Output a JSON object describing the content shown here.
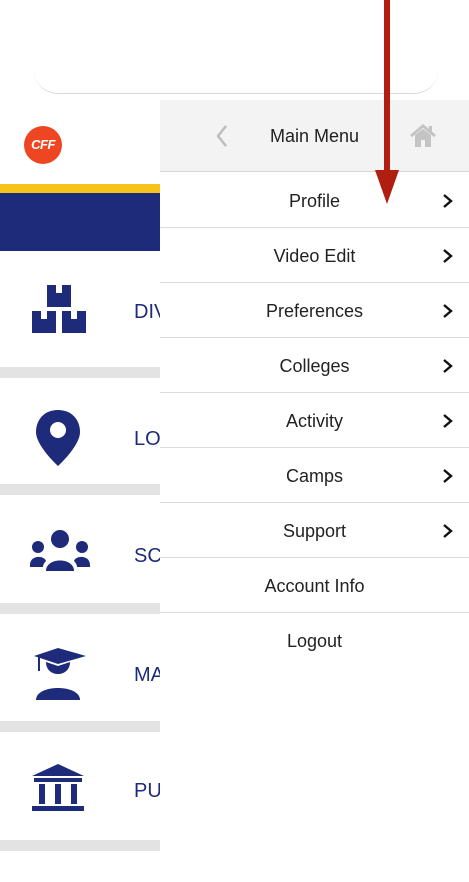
{
  "logo_text": "CFF",
  "menu": {
    "title": "Main Menu",
    "items": [
      {
        "label": "Profile",
        "has_chevron": true
      },
      {
        "label": "Video Edit",
        "has_chevron": true
      },
      {
        "label": "Preferences",
        "has_chevron": true
      },
      {
        "label": "Colleges",
        "has_chevron": true
      },
      {
        "label": "Activity",
        "has_chevron": true
      },
      {
        "label": "Camps",
        "has_chevron": true
      },
      {
        "label": "Support",
        "has_chevron": true
      },
      {
        "label": "Account Info",
        "has_chevron": false
      },
      {
        "label": "Logout",
        "has_chevron": false
      }
    ]
  },
  "left_nav": [
    {
      "label": "DIV",
      "icon": "boxes-icon"
    },
    {
      "label": "LOC",
      "icon": "location-pin-icon"
    },
    {
      "label": "SCH",
      "icon": "users-group-icon"
    },
    {
      "label": "MA",
      "icon": "graduate-icon"
    },
    {
      "label": "PUI",
      "icon": "institution-icon"
    }
  ],
  "colors": {
    "navy": "#1e2a7a",
    "yellow": "#f7c31b",
    "logo_red": "#ee4622",
    "annotation_arrow": "#b01e10"
  }
}
